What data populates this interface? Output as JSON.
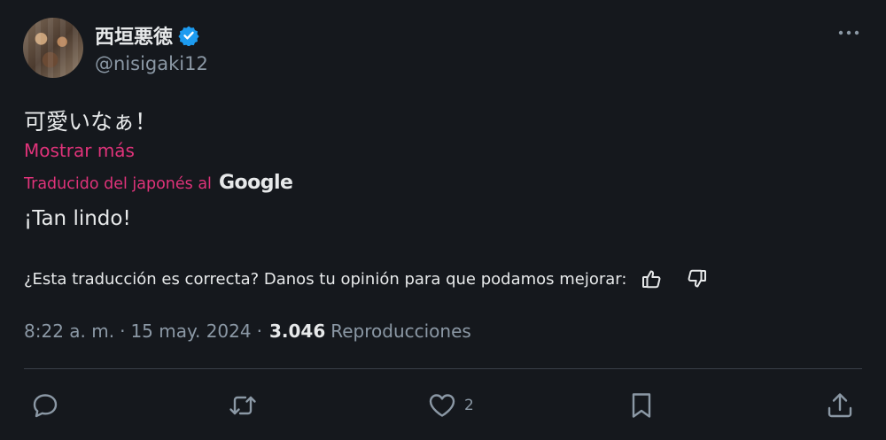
{
  "author": {
    "display_name": "西垣悪徳",
    "handle": "@nisigaki12",
    "verified_icon": "verified-badge-icon"
  },
  "tweet": {
    "text": "可愛いなぁ！",
    "show_more": "Mostrar más",
    "translated_by": "Traducido del japonés al",
    "translator_brand": "Google",
    "translation": "¡Tan lindo!",
    "feedback_question": "¿Esta traducción es correcta? Danos tu opinión para que podamos mejorar:"
  },
  "meta": {
    "time": "8:22 a. m.",
    "separator": "·",
    "date": "15 may. 2024",
    "views_count": "3.046",
    "views_label": "Reproducciones"
  },
  "actions": {
    "reply_count": "",
    "retweet_count": "",
    "like_count": "2"
  },
  "colors": {
    "background": "#15181d",
    "accent_link": "#e0337a",
    "verified": "#1d9bf0",
    "muted": "#8b98a5"
  }
}
